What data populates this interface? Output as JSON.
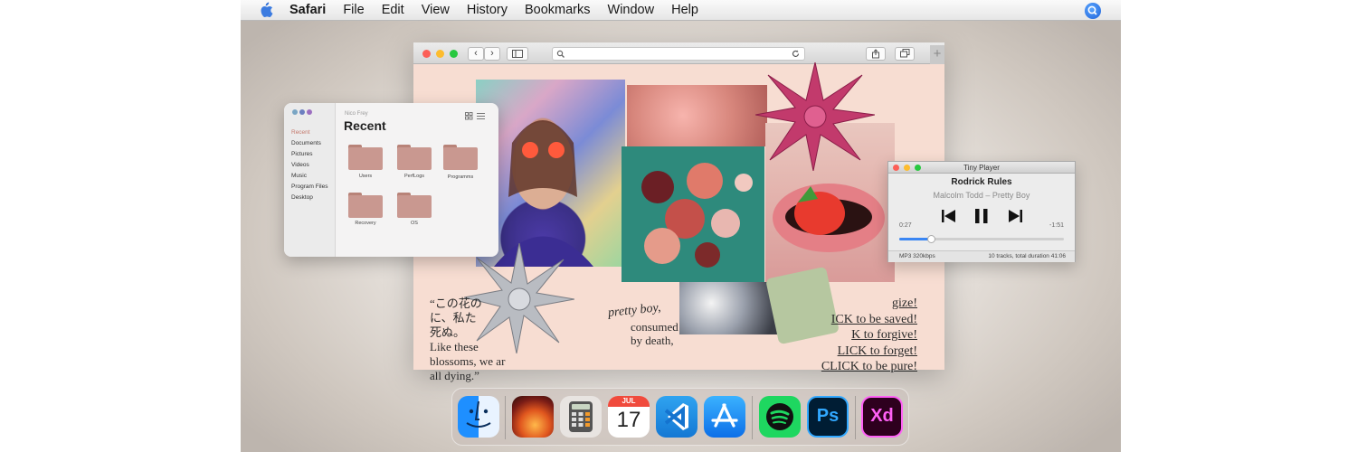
{
  "menubar": {
    "app_name": "Safari",
    "items": [
      "File",
      "Edit",
      "View",
      "History",
      "Bookmarks",
      "Window",
      "Help"
    ],
    "icons": [
      "apple-logo-icon",
      "spotlight-search-icon"
    ]
  },
  "safari": {
    "toolbar_icons": [
      "back-icon",
      "forward-icon",
      "sidebar-icon",
      "search-icon",
      "reload-icon",
      "share-icon",
      "tabs-icon",
      "new-tab-icon"
    ],
    "new_tab_glyph": "+",
    "page": {
      "quote_jp_1": "“この花の",
      "quote_jp_2": "に、私た",
      "quote_jp_3": "死ぬ。",
      "quote_en_1": "Like these",
      "quote_en_2": "blossoms, we ar",
      "quote_en_3": "all dying.”",
      "pretty_boy": "pretty boy,",
      "consumed_1": "consumed",
      "consumed_2": "by death,",
      "clicks": [
        "gize!",
        "ICK to be saved!",
        "K to forgive!",
        "LICK to forget!",
        "CLICK to be pure!"
      ]
    }
  },
  "finder": {
    "breadcrumb": "Nico Frey",
    "title": "Recent",
    "sidebar": [
      "Recent",
      "Documents",
      "Pictures",
      "Videos",
      "Music",
      "Program Files",
      "Desktop"
    ],
    "folders": [
      "Users",
      "PerfLogs",
      "Programms",
      "Recovery",
      "OS"
    ]
  },
  "player": {
    "window_title": "Tiny Player",
    "track_title": "Rodrick Rules",
    "artist_track": "Malcolm Todd – Pretty Boy",
    "elapsed": "0:27",
    "remaining": "-1:51",
    "progress": 0.19,
    "format": "MP3 320kbps",
    "summary": "10 tracks, total duration 41:06"
  },
  "dock": {
    "apps": [
      "finder-icon",
      "macos-ventura-icon",
      "calculator-icon",
      "calendar-icon",
      "vscode-icon",
      "app-store-icon",
      "spotify-icon",
      "photoshop-icon",
      "xd-icon"
    ],
    "calendar_month": "JUL",
    "calendar_day": "17",
    "ps_label": "Ps",
    "xd_label": "Xd"
  },
  "colors": {
    "page_bg": "#f7ddd2",
    "desktop": "#e9e4df",
    "progress_blue": "#3a86f3",
    "folder": "#c99890"
  }
}
